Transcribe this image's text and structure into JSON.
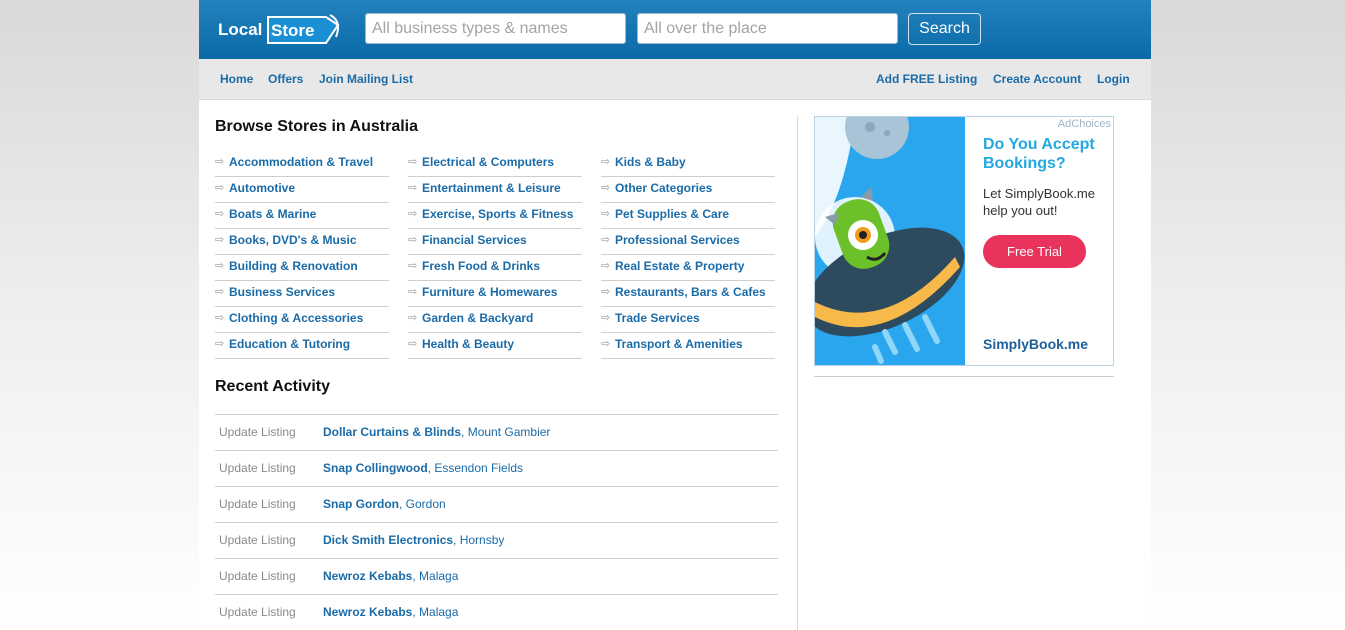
{
  "header": {
    "logo_text_left": "Local",
    "logo_text_right": "Store",
    "search_what_placeholder": "All business types & names",
    "search_where_placeholder": "All over the place",
    "search_button": "Search"
  },
  "nav": {
    "left": [
      "Home",
      "Offers",
      "Join Mailing List"
    ],
    "right": [
      "Add FREE Listing",
      "Create Account",
      "Login"
    ]
  },
  "browse": {
    "title": "Browse Stores in Australia",
    "icon": "arrow-right-icon",
    "columns": [
      [
        "Accommodation & Travel",
        "Automotive",
        "Boats & Marine",
        "Books, DVD's & Music",
        "Building & Renovation",
        "Business Services",
        "Clothing & Accessories",
        "Education & Tutoring"
      ],
      [
        "Electrical & Computers",
        "Entertainment & Leisure",
        "Exercise, Sports & Fitness",
        "Financial Services",
        "Fresh Food & Drinks",
        "Furniture & Homewares",
        "Garden & Backyard",
        "Health & Beauty"
      ],
      [
        "Kids & Baby",
        "Other Categories",
        "Pet Supplies & Care",
        "Professional Services",
        "Real Estate & Property",
        "Restaurants, Bars & Cafes",
        "Trade Services",
        "Transport & Amenities"
      ]
    ]
  },
  "activity": {
    "title": "Recent Activity",
    "rows": [
      {
        "type": "Update Listing",
        "name": "Dollar Curtains & Blinds",
        "location": "Mount Gambier"
      },
      {
        "type": "Update Listing",
        "name": "Snap Collingwood",
        "location": "Essendon Fields"
      },
      {
        "type": "Update Listing",
        "name": "Snap Gordon",
        "location": "Gordon"
      },
      {
        "type": "Update Listing",
        "name": "Dick Smith Electronics",
        "location": "Hornsby"
      },
      {
        "type": "Update Listing",
        "name": "Newroz Kebabs",
        "location": "Malaga"
      },
      {
        "type": "Update Listing",
        "name": "Newroz Kebabs",
        "location": "Malaga"
      }
    ]
  },
  "ad": {
    "choices": "AdChoices",
    "headline": "Do You Accept Bookings?",
    "body": "Let SimplyBook.me help you out!",
    "cta": "Free Trial",
    "brand": "SimplyBook.me"
  },
  "colors": {
    "header_blue": "#0a6aa8",
    "link_blue": "#1a6ba8",
    "ad_accent": "#23a8e0",
    "ad_cta": "#e9335c"
  }
}
